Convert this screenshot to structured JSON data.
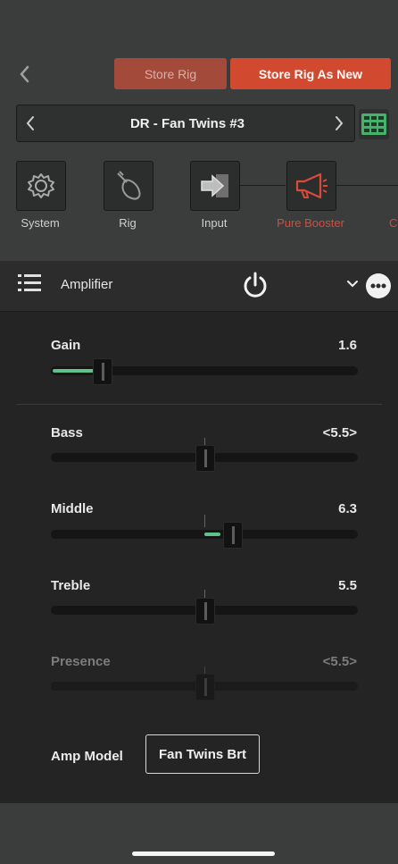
{
  "header": {
    "store_rig_label": "Store Rig",
    "store_rig_as_new_label": "Store Rig As New"
  },
  "rig": {
    "name": "DR - Fan Twins #3"
  },
  "chain": {
    "items": [
      {
        "label": "System",
        "icon": "gear-icon"
      },
      {
        "label": "Rig",
        "icon": "guitar-icon"
      },
      {
        "label": "Input",
        "icon": "input-arrow-icon"
      },
      {
        "label": "Pure Booster",
        "icon": "booster-megaphone-icon"
      },
      {
        "label": "C",
        "icon": ""
      }
    ]
  },
  "amp": {
    "title": "Amplifier"
  },
  "params": {
    "gain": {
      "label": "Gain",
      "value": "1.6"
    },
    "bass": {
      "label": "Bass",
      "value": "<5.5>"
    },
    "middle": {
      "label": "Middle",
      "value": "6.3"
    },
    "treble": {
      "label": "Treble",
      "value": "5.5"
    },
    "presence": {
      "label": "Presence",
      "value": "<5.5>"
    }
  },
  "amp_model": {
    "label": "Amp Model",
    "value": "Fan Twins Brt"
  },
  "colors": {
    "accent_red": "#d14a30",
    "store_red": "#a34a3a",
    "green": "#5fc18c",
    "grid_green": "#47b26b"
  }
}
